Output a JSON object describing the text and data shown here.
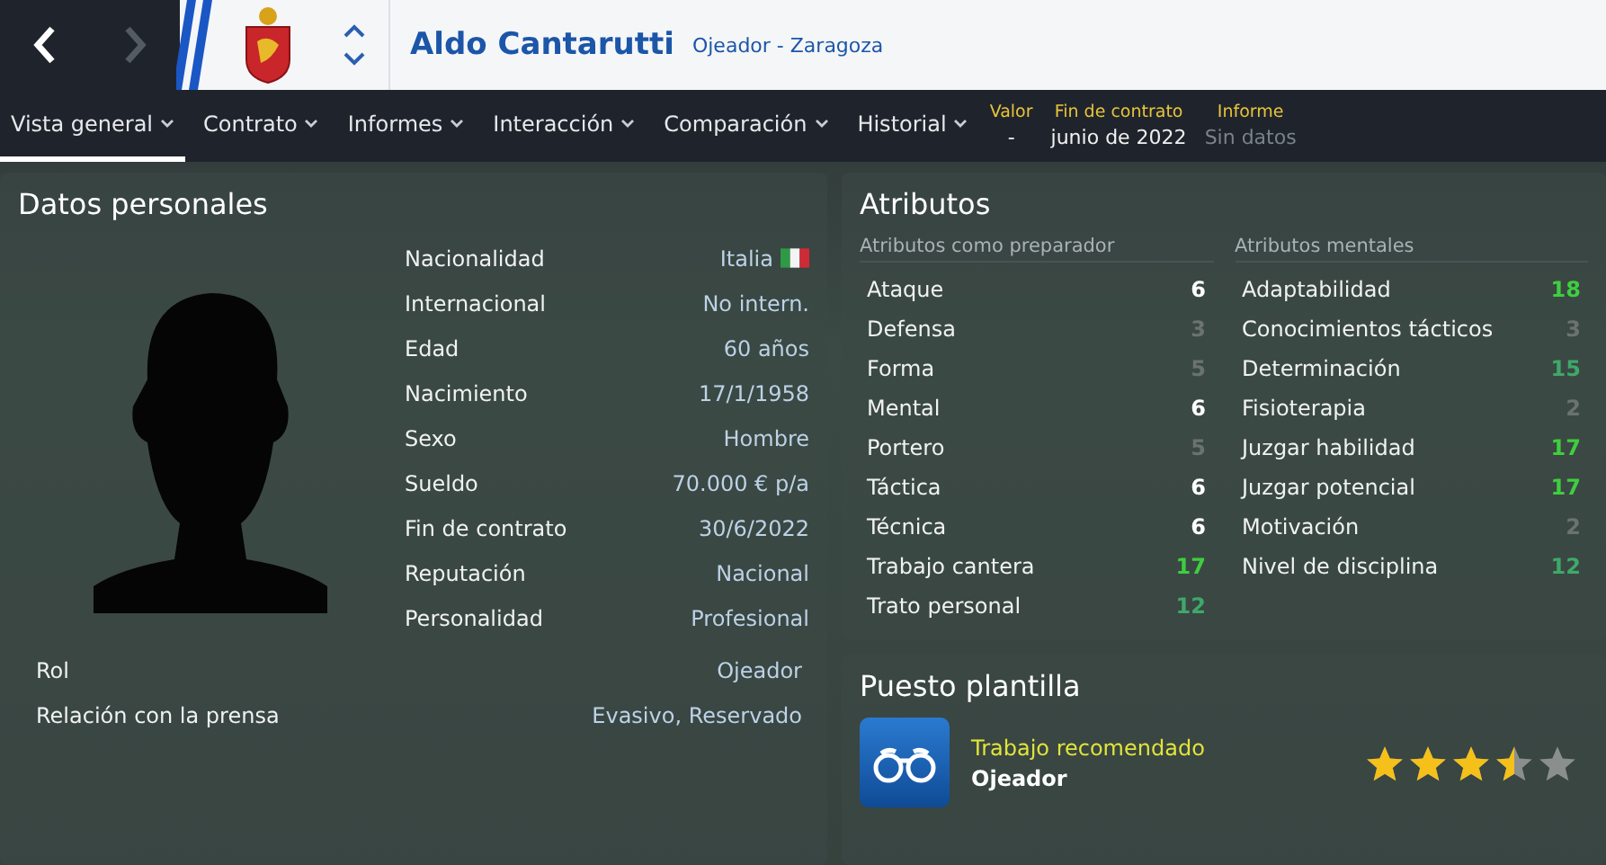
{
  "header": {
    "name": "Aldo Cantarutti",
    "subtitle": "Ojeador - Zaragoza",
    "back_disabled": false,
    "forward_disabled": true
  },
  "tabs": [
    {
      "label": "Vista general",
      "selected": true
    },
    {
      "label": "Contrato",
      "selected": false
    },
    {
      "label": "Informes",
      "selected": false
    },
    {
      "label": "Interacción",
      "selected": false
    },
    {
      "label": "Comparación",
      "selected": false
    },
    {
      "label": "Historial",
      "selected": false
    }
  ],
  "summary": [
    {
      "label": "Valor",
      "value": "-",
      "muted": false
    },
    {
      "label": "Fin de contrato",
      "value": "junio de 2022",
      "muted": false
    },
    {
      "label": "Informe",
      "value": "Sin datos",
      "muted": true
    }
  ],
  "personal": {
    "title": "Datos personales",
    "rows": [
      {
        "label": "Nacionalidad",
        "value": "Italia",
        "has_flag": true
      },
      {
        "label": "Internacional",
        "value": "No intern.",
        "has_flag": false
      },
      {
        "label": "Edad",
        "value": "60 años",
        "has_flag": false
      },
      {
        "label": "Nacimiento",
        "value": "17/1/1958",
        "has_flag": false
      },
      {
        "label": "Sexo",
        "value": "Hombre",
        "has_flag": false
      },
      {
        "label": "Sueldo",
        "value": "70.000 € p/a",
        "has_flag": false
      },
      {
        "label": "Fin de contrato",
        "value": "30/6/2022",
        "has_flag": false
      },
      {
        "label": "Reputación",
        "value": "Nacional",
        "has_flag": false
      },
      {
        "label": "Personalidad",
        "value": "Profesional",
        "has_flag": false
      }
    ],
    "extra_rows": [
      {
        "label": "Rol",
        "value": "Ojeador"
      },
      {
        "label": "Relación con la prensa",
        "value": "Evasivo, Reservado"
      }
    ]
  },
  "attributes": {
    "title": "Atributos",
    "groups": [
      {
        "title": "Atributos como preparador",
        "items": [
          {
            "name": "Ataque",
            "value": "6",
            "color": "#ffffff"
          },
          {
            "name": "Defensa",
            "value": "3",
            "color": "#6b7370"
          },
          {
            "name": "Forma",
            "value": "5",
            "color": "#6b7370"
          },
          {
            "name": "Mental",
            "value": "6",
            "color": "#ffffff"
          },
          {
            "name": "Portero",
            "value": "5",
            "color": "#6b7370"
          },
          {
            "name": "Táctica",
            "value": "6",
            "color": "#ffffff"
          },
          {
            "name": "Técnica",
            "value": "6",
            "color": "#ffffff"
          },
          {
            "name": "Trabajo cantera",
            "value": "17",
            "color": "#3fce3f"
          },
          {
            "name": "Trato personal",
            "value": "12",
            "color": "#3fa86a"
          }
        ]
      },
      {
        "title": "Atributos mentales",
        "items": [
          {
            "name": "Adaptabilidad",
            "value": "18",
            "color": "#3fce3f"
          },
          {
            "name": "Conocimientos tácticos",
            "value": "3",
            "color": "#6b7370"
          },
          {
            "name": "Determinación",
            "value": "15",
            "color": "#3fa86a"
          },
          {
            "name": "Fisioterapia",
            "value": "2",
            "color": "#6b7370"
          },
          {
            "name": "Juzgar habilidad",
            "value": "17",
            "color": "#3fce3f"
          },
          {
            "name": "Juzgar potencial",
            "value": "17",
            "color": "#3fce3f"
          },
          {
            "name": "Motivación",
            "value": "2",
            "color": "#6b7370"
          },
          {
            "name": "Nivel de disciplina",
            "value": "12",
            "color": "#3fa86a"
          }
        ]
      }
    ]
  },
  "squad_role": {
    "title": "Puesto plantilla",
    "label": "Trabajo recomendado",
    "role": "Ojeador",
    "stars": 3.5
  }
}
